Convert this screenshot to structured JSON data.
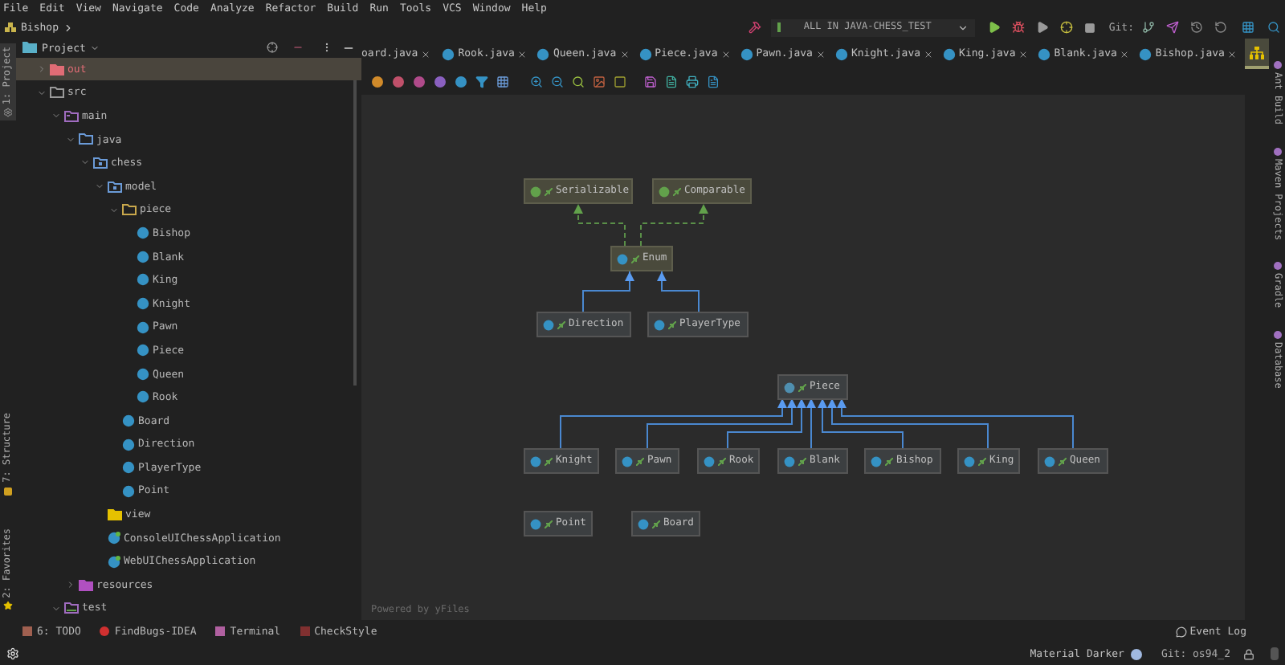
{
  "menu": [
    "File",
    "Edit",
    "View",
    "Navigate",
    "Code",
    "Analyze",
    "Refactor",
    "Build",
    "Run",
    "Tools",
    "VCS",
    "Window",
    "Help"
  ],
  "breadcrumb": "Bishop",
  "run_config": "ALL IN JAVA-CHESS_TEST",
  "git_label": "Git:",
  "left_tools": [
    {
      "label": "1: Project",
      "selected": true
    },
    {
      "label": "7: Structure",
      "selected": false
    },
    {
      "label": "2: Favorites",
      "selected": false
    }
  ],
  "right_tools": [
    "Ant Build",
    "Maven Projects",
    "Gradle",
    "Database"
  ],
  "project_panel": {
    "title": "Project",
    "tree": [
      {
        "name": "out",
        "kind": "excluded",
        "expanded": false,
        "selected": true
      },
      {
        "name": "src",
        "kind": "folder",
        "expanded": true,
        "selected": false,
        "children": [
          {
            "name": "main",
            "kind": "module",
            "expanded": true,
            "selected": false,
            "children": [
              {
                "name": "java",
                "kind": "source",
                "expanded": true,
                "selected": false,
                "children": [
                  {
                    "name": "chess",
                    "kind": "package",
                    "expanded": true,
                    "selected": false,
                    "children": [
                      {
                        "name": "model",
                        "kind": "package",
                        "expanded": true,
                        "selected": false,
                        "children": [
                          {
                            "name": "piece",
                            "kind": "package-open",
                            "expanded": true,
                            "selected": false,
                            "children": [
                              {
                                "name": "Bishop",
                                "kind": "class",
                                "selected": false
                              },
                              {
                                "name": "Blank",
                                "kind": "class",
                                "selected": false
                              },
                              {
                                "name": "King",
                                "kind": "class",
                                "selected": false
                              },
                              {
                                "name": "Knight",
                                "kind": "class",
                                "selected": false
                              },
                              {
                                "name": "Pawn",
                                "kind": "class",
                                "selected": false
                              },
                              {
                                "name": "Piece",
                                "kind": "class",
                                "selected": false
                              },
                              {
                                "name": "Queen",
                                "kind": "class",
                                "selected": false
                              },
                              {
                                "name": "Rook",
                                "kind": "class",
                                "selected": false
                              }
                            ]
                          },
                          {
                            "name": "Board",
                            "kind": "class",
                            "selected": false
                          },
                          {
                            "name": "Direction",
                            "kind": "class",
                            "selected": false
                          },
                          {
                            "name": "PlayerType",
                            "kind": "class",
                            "selected": false
                          },
                          {
                            "name": "Point",
                            "kind": "class",
                            "selected": false
                          }
                        ]
                      },
                      {
                        "name": "view",
                        "kind": "package-filled",
                        "selected": false
                      },
                      {
                        "name": "ConsoleUIChessApplication",
                        "kind": "app",
                        "selected": false
                      },
                      {
                        "name": "WebUIChessApplication",
                        "kind": "app",
                        "selected": false
                      }
                    ]
                  }
                ]
              },
              {
                "name": "resources",
                "kind": "resources",
                "expanded": false,
                "selected": false
              }
            ]
          },
          {
            "name": "test",
            "kind": "test",
            "expanded": true,
            "selected": false
          }
        ]
      }
    ]
  },
  "tabs": [
    {
      "kind": "file",
      "label": "oard.java",
      "cut": true,
      "selected": false
    },
    {
      "kind": "file",
      "label": "Rook.java",
      "cut": false,
      "selected": false
    },
    {
      "kind": "file",
      "label": "Queen.java",
      "cut": false,
      "selected": false
    },
    {
      "kind": "file",
      "label": "Piece.java",
      "cut": false,
      "selected": false
    },
    {
      "kind": "file",
      "label": "Pawn.java",
      "cut": false,
      "selected": false
    },
    {
      "kind": "file",
      "label": "Knight.java",
      "cut": false,
      "selected": false
    },
    {
      "kind": "file",
      "label": "King.java",
      "cut": false,
      "selected": false
    },
    {
      "kind": "file",
      "label": "Blank.java",
      "cut": false,
      "selected": false
    },
    {
      "kind": "file",
      "label": "Bishop.java",
      "cut": false,
      "selected": false
    },
    {
      "kind": "diagram",
      "selected": true
    }
  ],
  "diagram": {
    "nodes": [
      {
        "name": "Serializable",
        "kind": "library-interface"
      },
      {
        "name": "Comparable",
        "kind": "library-interface"
      },
      {
        "name": "Enum",
        "kind": "library-class"
      },
      {
        "name": "Direction",
        "kind": "enum"
      },
      {
        "name": "PlayerType",
        "kind": "enum"
      },
      {
        "name": "Piece",
        "kind": "abstract"
      },
      {
        "name": "Knight",
        "kind": "class"
      },
      {
        "name": "Pawn",
        "kind": "class"
      },
      {
        "name": "Rook",
        "kind": "class"
      },
      {
        "name": "Blank",
        "kind": "class"
      },
      {
        "name": "Bishop",
        "kind": "class"
      },
      {
        "name": "King",
        "kind": "class"
      },
      {
        "name": "Queen",
        "kind": "class"
      },
      {
        "name": "Point",
        "kind": "class"
      },
      {
        "name": "Board",
        "kind": "class"
      }
    ],
    "footer": "Powered by yFiles"
  },
  "bottom_tools": [
    "6: TODO",
    "FindBugs-IDEA",
    "Terminal",
    "CheckStyle"
  ],
  "event_log": "Event Log",
  "status": {
    "theme": "Material Darker",
    "git": "Git: os94_2"
  }
}
